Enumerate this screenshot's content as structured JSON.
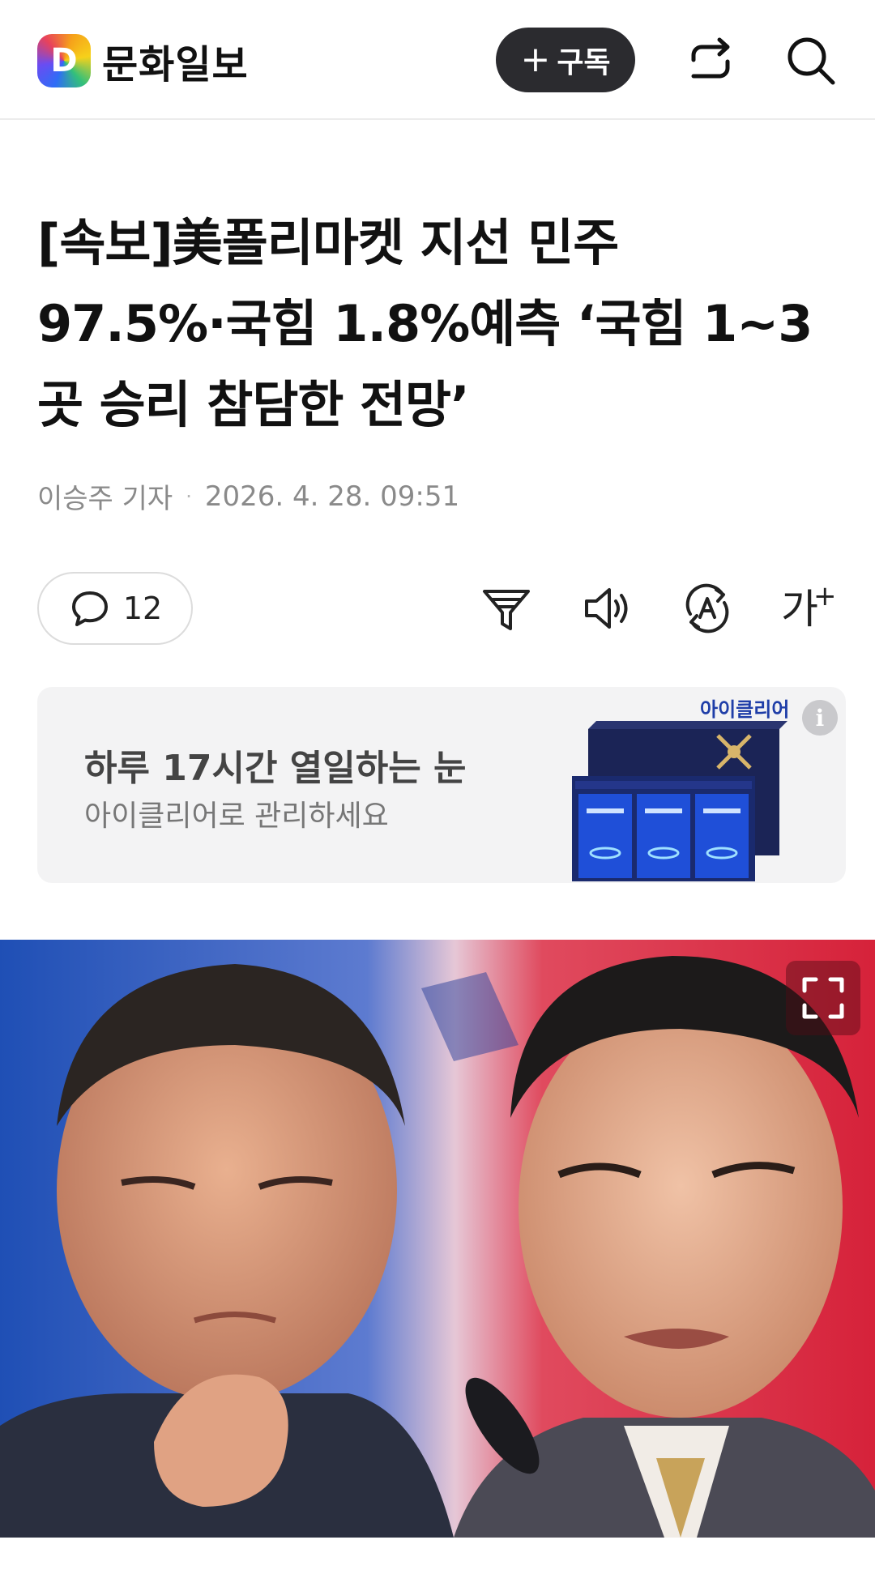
{
  "header": {
    "logo_letter": "D",
    "logo_text": "문화일보",
    "subscribe_plus": "+",
    "subscribe_label": "구독",
    "share_icon": "share-icon",
    "search_icon": "search-icon"
  },
  "article": {
    "title_line1": "[속보]美폴리마켓 지선 민주",
    "title_line2": "97.5%·국힘 1.8%예측 ‘국힘 1~3",
    "title_line3": "곳 승리 참담한 전망’",
    "author": "이승주 기자",
    "separator": "·",
    "datetime": "2026. 4. 28. 09:51"
  },
  "toolbar": {
    "comment_count": "12",
    "font_label": "가",
    "font_plus": "+"
  },
  "ad": {
    "headline": "하루 17시간 열일하는 눈",
    "subline": "아이클리어로 관리하세요",
    "brand": "아이클리어",
    "info": "i"
  },
  "colors": {
    "subscribe_bg": "#2b2b2f",
    "ad_bg": "#f3f3f4",
    "brand_blue": "#1f3ea8",
    "photo_left": "#1f4fb5",
    "photo_right": "#d6223a"
  }
}
